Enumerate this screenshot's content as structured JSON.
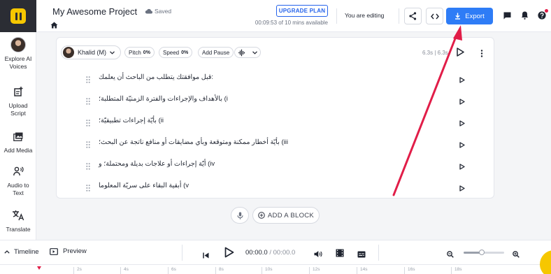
{
  "app": {
    "logo_icon": "app-logo-icon"
  },
  "rail": {
    "items": [
      {
        "label": "Explore AI Voices",
        "icon": "voice-avatar"
      },
      {
        "label": "Upload Script",
        "icon": "upload-script-icon"
      },
      {
        "label": "Add Media",
        "icon": "media-icon"
      },
      {
        "label": "Audio to Text",
        "icon": "audio-to-text-icon"
      },
      {
        "label": "Translate",
        "icon": "translate-icon"
      }
    ]
  },
  "header": {
    "project_title": "My Awesome Project",
    "saved_status": "Saved",
    "upgrade_label": "UPGRADE PLAN",
    "usage_text": "00:09:53 of 10 mins available",
    "editing_status": "You are editing",
    "export_label": "Export"
  },
  "toolbar": {
    "voice_name": "Khalid (M)",
    "pitch_label": "Pitch",
    "pitch_value": "0%",
    "speed_label": "Speed",
    "speed_value": "0%",
    "pause_label": "Add Pause",
    "duration_text": "6.3s | 6.3s"
  },
  "blocks": [
    {
      "text": "قبل موافقتك يتطلب من الباحث أن يعلمك:"
    },
    {
      "text": "بالأهداف والإجراءات والفترة الزمنيّة المتطلبة؛ (i"
    },
    {
      "text": "بأيّة إجراءات تطبيقيّة؛ (ii"
    },
    {
      "text": "بأيّة أخطار ممكنة ومتوقعة وبأي مضايقات أو منافع ناتجة عن البحث؛ (iii"
    },
    {
      "text": "أيّة إجراءات أو علاجات بديلة ومحتملة؛ و (iv"
    },
    {
      "text": "أبقية البقاء على سريّة المعلوما (v"
    }
  ],
  "add_block_label": "ADD A BLOCK",
  "player": {
    "timeline_label": "Timeline",
    "preview_label": "Preview",
    "current_time": "00:00.0",
    "separator": " / ",
    "total_time": "00:00.0",
    "zoom_level": 0.45
  },
  "ruler": {
    "ticks": [
      "2s",
      "4s",
      "6s",
      "8s",
      "10s",
      "12s",
      "14s",
      "16s",
      "18s"
    ]
  },
  "colors": {
    "accent": "#2e7cf6",
    "annotation_arrow": "#e11d48",
    "logo": "#f6c700"
  }
}
